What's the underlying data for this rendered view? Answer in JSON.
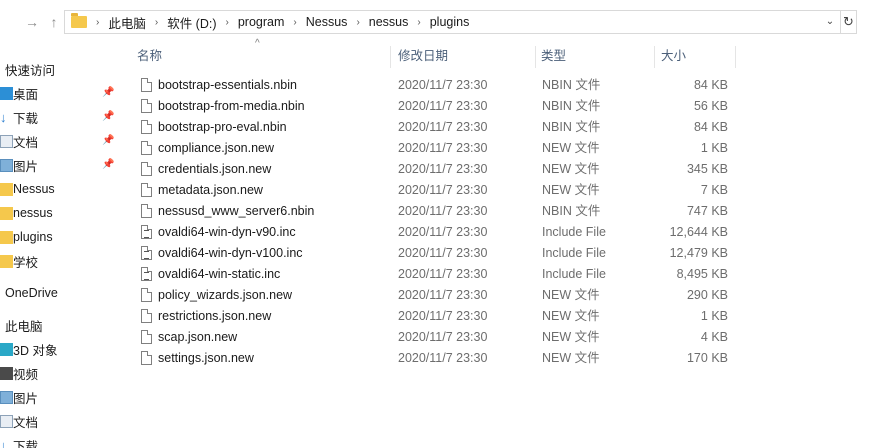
{
  "address": {
    "crumbs": [
      "此电脑",
      "软件 (D:)",
      "program",
      "Nessus",
      "nessus",
      "plugins"
    ]
  },
  "nav": {
    "quick_access_label": "快速访问",
    "quick_items": [
      {
        "label": "桌面",
        "icon": "desktop-icon",
        "pinned": true
      },
      {
        "label": "下载",
        "icon": "download-icon",
        "pinned": true
      },
      {
        "label": "文档",
        "icon": "document-icon",
        "pinned": true
      },
      {
        "label": "图片",
        "icon": "picture-icon",
        "pinned": true
      },
      {
        "label": "Nessus",
        "icon": "folder-icon",
        "pinned": false
      },
      {
        "label": "nessus",
        "icon": "folder-icon",
        "pinned": false
      },
      {
        "label": "plugins",
        "icon": "folder-icon",
        "pinned": false
      },
      {
        "label": "学校",
        "icon": "folder-icon",
        "pinned": false
      }
    ],
    "onedrive_label": "OneDrive",
    "this_pc_label": "此电脑",
    "pc_items": [
      {
        "label": "3D 对象",
        "icon": "3d-objects-icon"
      },
      {
        "label": "视频",
        "icon": "video-icon"
      },
      {
        "label": "图片",
        "icon": "picture-icon"
      },
      {
        "label": "文档",
        "icon": "document-icon"
      },
      {
        "label": "下载",
        "icon": "download-icon"
      }
    ]
  },
  "columns": {
    "name": "名称",
    "date": "修改日期",
    "type": "类型",
    "size": "大小"
  },
  "files": [
    {
      "name": "bootstrap-essentials.nbin",
      "date": "2020/11/7 23:30",
      "type": "NBIN 文件",
      "size": "84 KB"
    },
    {
      "name": "bootstrap-from-media.nbin",
      "date": "2020/11/7 23:30",
      "type": "NBIN 文件",
      "size": "56 KB"
    },
    {
      "name": "bootstrap-pro-eval.nbin",
      "date": "2020/11/7 23:30",
      "type": "NBIN 文件",
      "size": "84 KB"
    },
    {
      "name": "compliance.json.new",
      "date": "2020/11/7 23:30",
      "type": "NEW 文件",
      "size": "1 KB"
    },
    {
      "name": "credentials.json.new",
      "date": "2020/11/7 23:30",
      "type": "NEW 文件",
      "size": "345 KB"
    },
    {
      "name": "metadata.json.new",
      "date": "2020/11/7 23:30",
      "type": "NEW 文件",
      "size": "7 KB"
    },
    {
      "name": "nessusd_www_server6.nbin",
      "date": "2020/11/7 23:30",
      "type": "NBIN 文件",
      "size": "747 KB"
    },
    {
      "name": "ovaldi64-win-dyn-v90.inc",
      "date": "2020/11/7 23:30",
      "type": "Include File",
      "size": "12,644 KB"
    },
    {
      "name": "ovaldi64-win-dyn-v100.inc",
      "date": "2020/11/7 23:30",
      "type": "Include File",
      "size": "12,479 KB"
    },
    {
      "name": "ovaldi64-win-static.inc",
      "date": "2020/11/7 23:30",
      "type": "Include File",
      "size": "8,495 KB"
    },
    {
      "name": "policy_wizards.json.new",
      "date": "2020/11/7 23:30",
      "type": "NEW 文件",
      "size": "290 KB"
    },
    {
      "name": "restrictions.json.new",
      "date": "2020/11/7 23:30",
      "type": "NEW 文件",
      "size": "1 KB"
    },
    {
      "name": "scap.json.new",
      "date": "2020/11/7 23:30",
      "type": "NEW 文件",
      "size": "4 KB"
    },
    {
      "name": "settings.json.new",
      "date": "2020/11/7 23:30",
      "type": "NEW 文件",
      "size": "170 KB"
    }
  ]
}
